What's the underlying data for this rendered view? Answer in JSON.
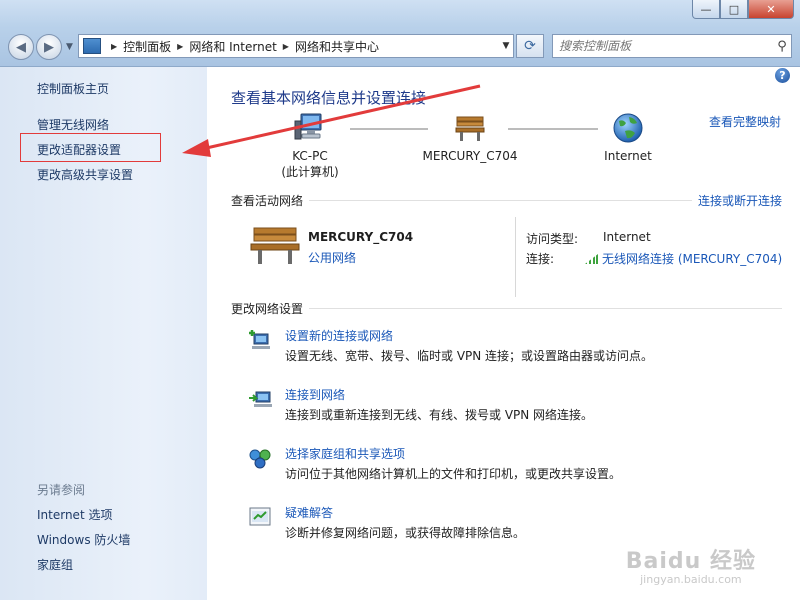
{
  "window": {
    "minimize": "—",
    "maximize": "□",
    "close": "✕"
  },
  "nav": {
    "back_icon": "back-arrow-icon",
    "forward_icon": "forward-arrow-icon",
    "breadcrumb": [
      "控制面板",
      "网络和 Internet",
      "网络和共享中心"
    ],
    "search_placeholder": "搜索控制面板"
  },
  "sidebar": {
    "items": [
      {
        "label": "控制面板主页"
      },
      {
        "label": "管理无线网络"
      },
      {
        "label": "更改适配器设置"
      },
      {
        "label": "更改高级共享设置"
      }
    ],
    "see_also_heading": "另请参阅",
    "see_also": [
      {
        "label": "Internet 选项"
      },
      {
        "label": "Windows 防火墙"
      },
      {
        "label": "家庭组"
      }
    ]
  },
  "main": {
    "help": "?",
    "title": "查看基本网络信息并设置连接",
    "view_full_map": "查看完整映射",
    "map_nodes": [
      {
        "name": "KC-PC",
        "sub": "(此计算机)",
        "icon": "computer-icon"
      },
      {
        "name": "MERCURY_C704",
        "sub": "",
        "icon": "bench-network-icon"
      },
      {
        "name": "Internet",
        "sub": "",
        "icon": "globe-icon"
      }
    ],
    "active_section_title": "查看活动网络",
    "connect_disconnect": "连接或断开连接",
    "active_network": {
      "name": "MERCURY_C704",
      "type": "公用网络",
      "access_type_label": "访问类型:",
      "access_type_value": "Internet",
      "connection_label": "连接:",
      "connection_value": "无线网络连接 (MERCURY_C704)"
    },
    "change_section_title": "更改网络设置",
    "tasks": [
      {
        "link": "设置新的连接或网络",
        "desc": "设置无线、宽带、拨号、临时或 VPN 连接；或设置路由器或访问点。",
        "icon": "new-connection-icon"
      },
      {
        "link": "连接到网络",
        "desc": "连接到或重新连接到无线、有线、拨号或 VPN 网络连接。",
        "icon": "connect-network-icon"
      },
      {
        "link": "选择家庭组和共享选项",
        "desc": "访问位于其他网络计算机上的文件和打印机，或更改共享设置。",
        "icon": "homegroup-icon"
      },
      {
        "link": "疑难解答",
        "desc": "诊断并修复网络问题，或获得故障排除信息。",
        "icon": "troubleshoot-icon"
      }
    ]
  },
  "watermark": {
    "brand": "Baidu 经验",
    "sub": "jingyan.baidu.com"
  }
}
